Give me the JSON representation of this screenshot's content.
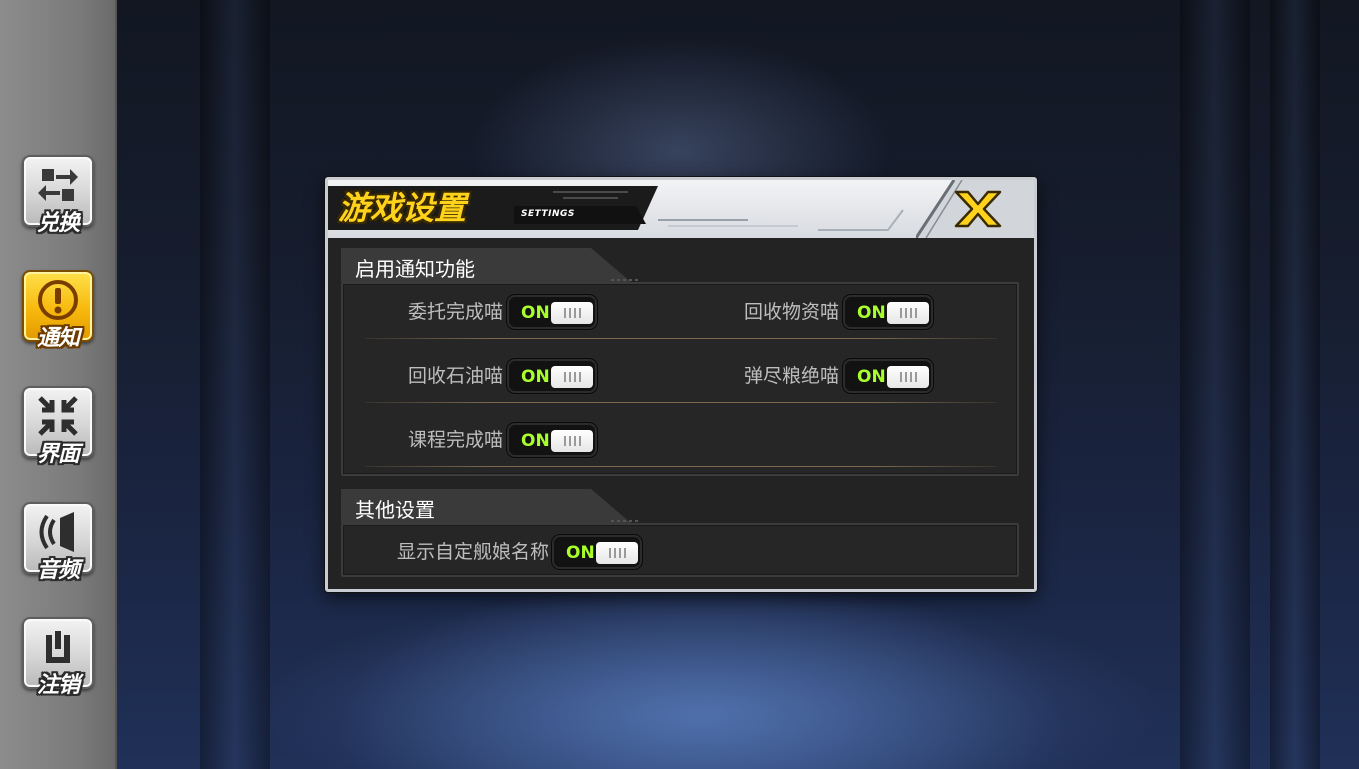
{
  "sidebar": {
    "items": [
      {
        "label": "兑换",
        "icon": "exchange-icon",
        "active": false
      },
      {
        "label": "通知",
        "icon": "alert-icon",
        "active": true
      },
      {
        "label": "界面",
        "icon": "shrink-arrows-icon",
        "active": false
      },
      {
        "label": "音频",
        "icon": "speaker-icon",
        "active": false
      },
      {
        "label": "注销",
        "icon": "power-icon",
        "active": false
      }
    ]
  },
  "dialog": {
    "title": "游戏设置",
    "subtitle": "SETTINGS",
    "close_icon": "close-x-icon",
    "sections": [
      {
        "title": "启用通知功能",
        "options": [
          {
            "label": "委托完成喵",
            "state": "ON"
          },
          {
            "label": "回收物资喵",
            "state": "ON"
          },
          {
            "label": "回收石油喵",
            "state": "ON"
          },
          {
            "label": "弹尽粮绝喵",
            "state": "ON"
          },
          {
            "label": "课程完成喵",
            "state": "ON"
          }
        ]
      },
      {
        "title": "其他设置",
        "options": [
          {
            "label": "显示自定舰娘名称",
            "state": "ON"
          }
        ]
      }
    ]
  },
  "colors": {
    "accent_yellow": "#ffd21c",
    "toggle_on_text": "#a8ff2a",
    "panel_bg": "#232323",
    "sidebar_bg": "#7a7a7a"
  }
}
